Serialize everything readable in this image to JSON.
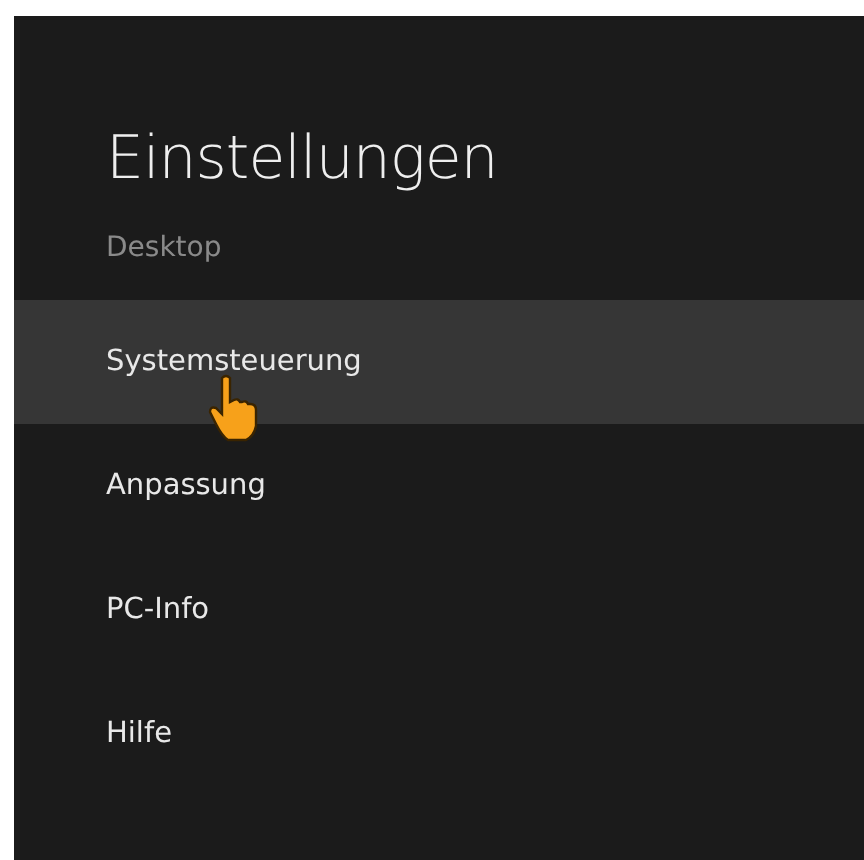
{
  "title": "Einstellungen",
  "subtitle": "Desktop",
  "items": [
    {
      "label": "Systemsteuerung",
      "selected": true
    },
    {
      "label": "Anpassung",
      "selected": false
    },
    {
      "label": "PC-Info",
      "selected": false
    },
    {
      "label": "Hilfe",
      "selected": false
    }
  ]
}
